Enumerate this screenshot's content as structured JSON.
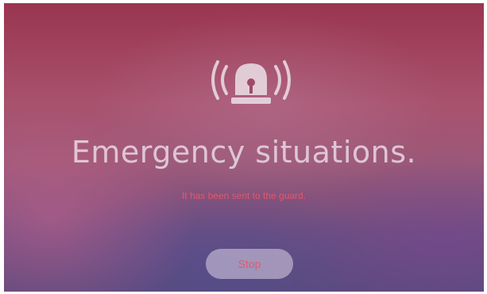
{
  "screen": {
    "title": "Emergency situations.",
    "subtitle": "It has been sent to the guard.",
    "stop_label": "Stop",
    "icon": "alarm-siren-icon"
  },
  "colors": {
    "title_text": "#f0e4ec",
    "subtitle_text": "#e5566a",
    "button_text": "#e05a6e",
    "background_top": "#9a3550",
    "background_bottom": "#5d4a7d"
  }
}
